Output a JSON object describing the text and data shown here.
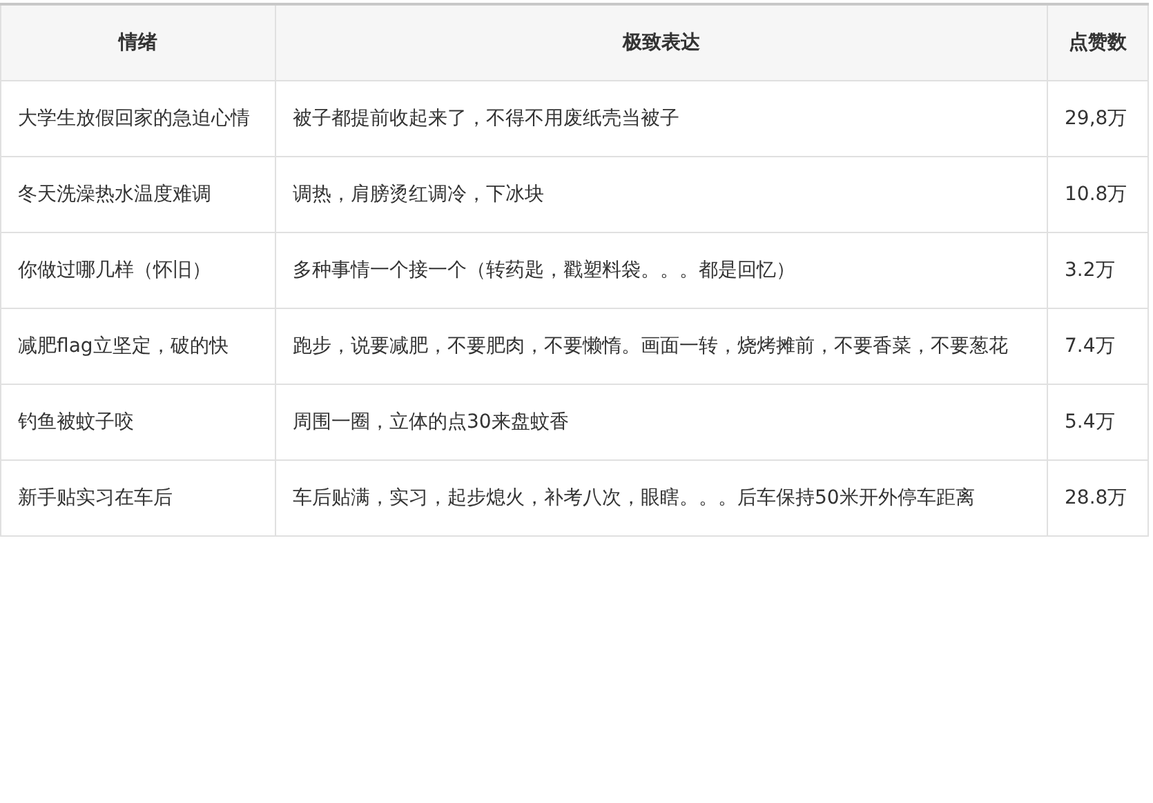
{
  "table": {
    "columns": [
      "情绪",
      "极致表达",
      "点赞数"
    ],
    "rows": [
      {
        "cells": [
          "大学生放假回家的急迫心情",
          "被子都提前收起来了，不得不用废纸壳当被子",
          "29,8万"
        ]
      },
      {
        "cells": [
          "冬天洗澡热水温度难调",
          "调热，肩膀烫红调冷，下冰块",
          "10.8万"
        ]
      },
      {
        "cells": [
          "你做过哪几样（怀旧）",
          "多种事情一个接一个（转药匙，戳塑料袋。。。都是回忆）",
          "3.2万"
        ]
      },
      {
        "cells": [
          "减肥flag立坚定，破的快",
          "跑步，说要减肥，不要肥肉，不要懒惰。画面一转，烧烤摊前，不要香菜，不要葱花",
          "7.4万"
        ]
      },
      {
        "cells": [
          "钓鱼被蚊子咬",
          "周围一圈，立体的点30来盘蚊香",
          "5.4万"
        ]
      },
      {
        "cells": [
          "新手贴实习在车后",
          "车后贴满，实习，起步熄火，补考八次，眼瞎。。。后车保持50米开外停车距离",
          "28.8万"
        ]
      }
    ]
  }
}
